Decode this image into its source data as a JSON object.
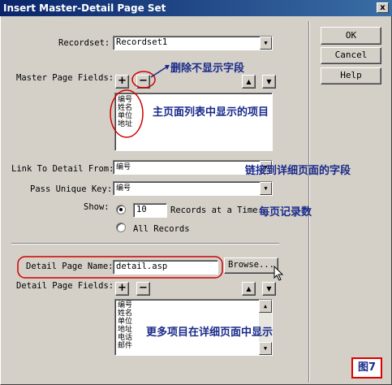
{
  "window": {
    "title": "Insert Master-Detail Page Set",
    "close_label": "x"
  },
  "buttons": {
    "ok": "OK",
    "cancel": "Cancel",
    "help": "Help"
  },
  "recordset": {
    "label": "Recordset:",
    "value": "Recordset1"
  },
  "master_fields": {
    "label": "Master Page Fields:",
    "add": "+",
    "remove": "−",
    "up": "▲",
    "down": "▼",
    "items": [
      "编号",
      "姓名",
      "单位",
      "地址"
    ]
  },
  "link_to_detail": {
    "label": "Link To Detail From:",
    "value": "编号"
  },
  "pass_unique_key": {
    "label": "Pass Unique Key:",
    "value": "编号"
  },
  "show": {
    "label": "Show:",
    "records_value": "10",
    "records_option": "Records at a Time",
    "all_option": "All Records",
    "selected": "records"
  },
  "detail_page_name": {
    "label": "Detail Page Name:",
    "value": "detail.asp",
    "browse": "Browse..."
  },
  "detail_fields": {
    "label": "Detail Page Fields:",
    "add": "+",
    "remove": "−",
    "up": "▲",
    "down": "▼",
    "items": [
      "编号",
      "姓名",
      "单位",
      "地址",
      "电话",
      "邮件"
    ]
  },
  "annotations": {
    "delete_fields": "删除不显示字段",
    "master_list": "主页面列表中显示的项目",
    "link_field": "链接到详细页面的字段",
    "per_page": "每页记录数",
    "more_items": "更多项目在详细页面中显示"
  },
  "figure_label": "图7",
  "colors": {
    "annotation": "#1a2a8a",
    "highlight_circle": "#d00000",
    "title_bar": "#0a246a"
  }
}
